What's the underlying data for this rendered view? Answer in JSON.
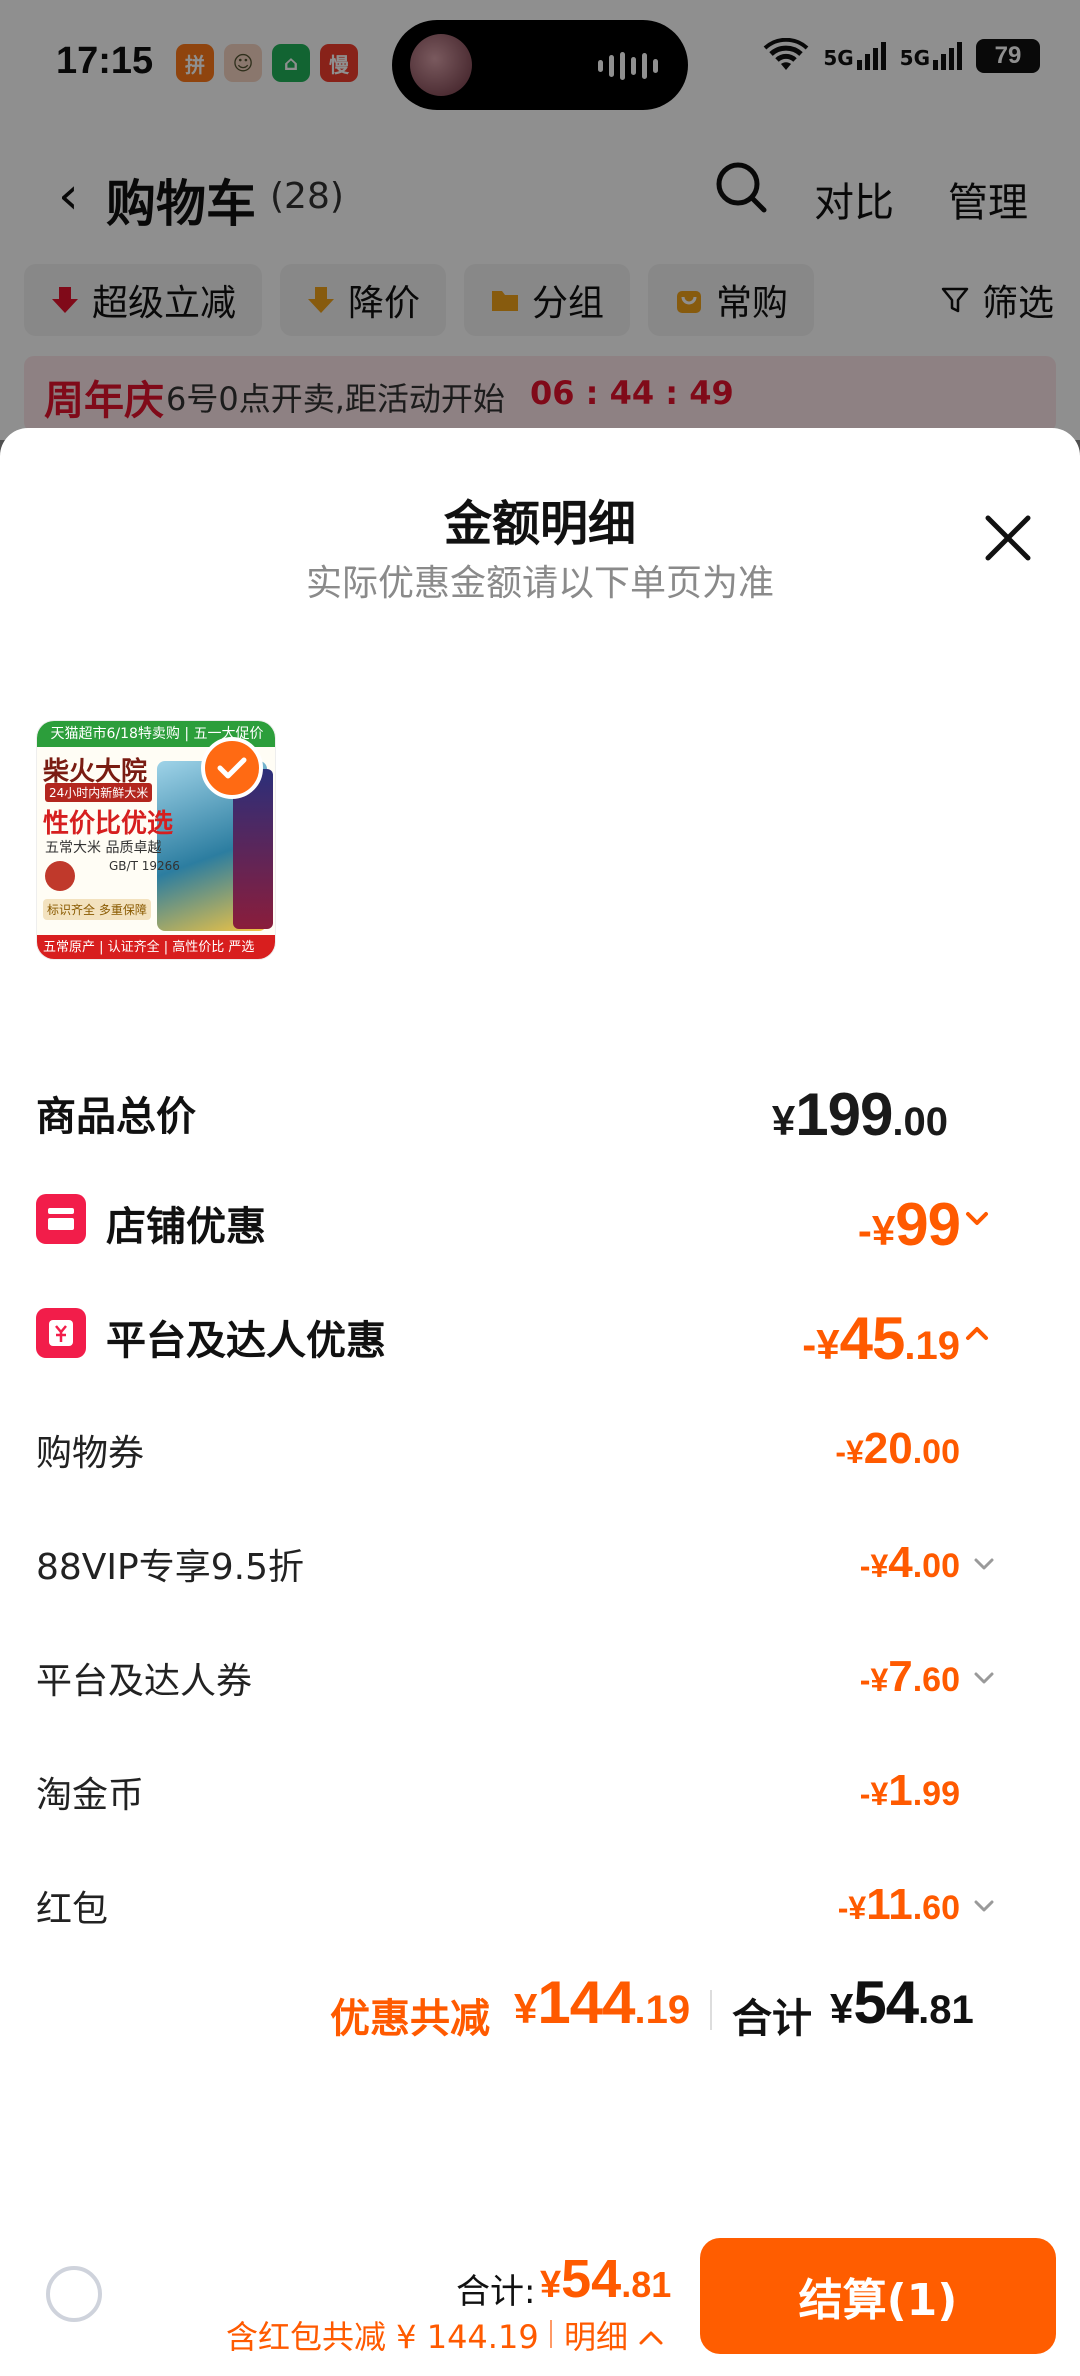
{
  "status_bar": {
    "time": "17:15",
    "battery": "79",
    "signal_1": "5G",
    "signal_2": "5G",
    "app_icons": [
      {
        "label": "拼",
        "color": "#ff7a1a"
      },
      {
        "label": "☺",
        "color": "#f6d4c2"
      },
      {
        "label": "⌂",
        "color": "#21b35a"
      },
      {
        "label": "慢",
        "color": "#f23d2d"
      }
    ]
  },
  "nav": {
    "title": "购物车",
    "count": "(28)",
    "compare": "对比",
    "manage": "管理"
  },
  "filters": [
    {
      "label": "超级立减",
      "icon": "down-arrow-icon",
      "color": "#e4132e"
    },
    {
      "label": "降价",
      "icon": "price-down-icon",
      "color": "#f0a21a"
    },
    {
      "label": "分组",
      "icon": "folder-icon",
      "color": "#f0a21a"
    },
    {
      "label": "常购",
      "icon": "bag-icon",
      "color": "#f0a21a"
    }
  ],
  "filter_button": "筛选",
  "promo": {
    "tag": "周年庆",
    "text": "6号0点开卖,距活动开始",
    "countdown": "06 : 44 : 49"
  },
  "sheet": {
    "title": "金额明细",
    "subtitle": "实际优惠金额请以下单页为准"
  },
  "product": {
    "top_banner": "天猫超市6/18特卖购 | 五一大促价",
    "brand": "柴火大院",
    "sub": "24小时内新鲜大米",
    "value_text": "性价比优选",
    "rice_text": "五常大米 品质卓越",
    "gb_text": "GB/T 19266",
    "feature": "标识齐全 多重保障",
    "bottom_banner": "五常原产 | 认证齐全 | 高性价比 严选"
  },
  "rows": {
    "total": {
      "label": "商品总价",
      "currency": "¥",
      "int": "199",
      "dec": ".00"
    },
    "shop": {
      "label": "店铺优惠",
      "currency": "-¥",
      "int": "99",
      "dec": ""
    },
    "platform": {
      "label": "平台及达人优惠",
      "currency": "-¥",
      "int": "45",
      "dec": ".19"
    }
  },
  "sub_items": [
    {
      "label": "购物券",
      "currency": "-¥",
      "int": "20",
      "dec": ".00",
      "chevron": false
    },
    {
      "label": "88VIP专享9.5折",
      "currency": "-¥",
      "int": "4",
      "dec": ".00",
      "chevron": true
    },
    {
      "label": "平台及达人券",
      "currency": "-¥",
      "int": "7",
      "dec": ".60",
      "chevron": true
    },
    {
      "label": "淘金币",
      "currency": "-¥",
      "int": "1",
      "dec": ".99",
      "chevron": false
    },
    {
      "label": "红包",
      "currency": "-¥",
      "int": "11",
      "dec": ".60",
      "chevron": true
    }
  ],
  "summary": {
    "discount_label": "优惠共减",
    "discount_currency": "¥",
    "discount_int": "144",
    "discount_dec": ".19",
    "total_label": "合计",
    "total_currency": "¥",
    "total_int": "54",
    "total_dec": ".81"
  },
  "bottom_bar": {
    "total_label": "合计:",
    "total_currency": "¥",
    "total_int": "54",
    "total_dec": ".81",
    "note": "含红包共减 ¥ 144.19",
    "detail": "明细",
    "checkout": "结算(1)"
  },
  "colors": {
    "accent": "#ff5a00",
    "promo_red": "#e4132e",
    "icon_red": "#f21d4a"
  }
}
